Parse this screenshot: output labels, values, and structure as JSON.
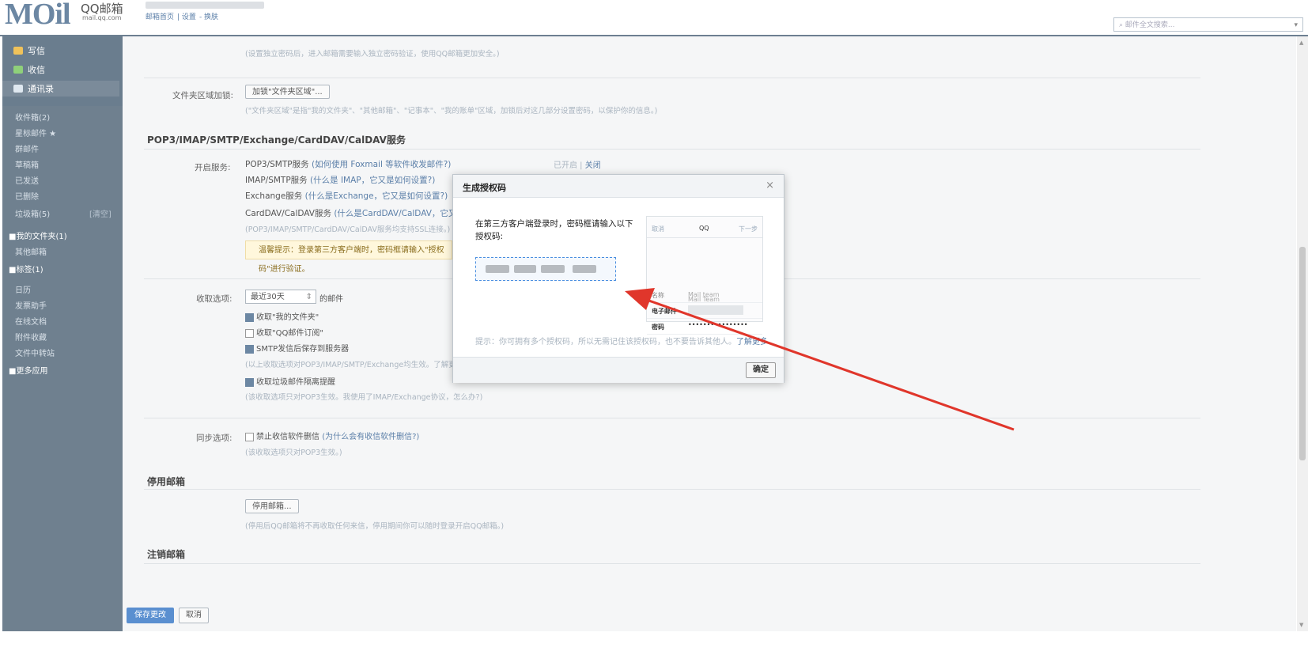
{
  "header": {
    "logo_m": "MOil",
    "logo_name": "QQ邮箱",
    "logo_domain": "mail.qq.com",
    "links": [
      "邮箱首页",
      "设置",
      "换肤"
    ],
    "search_placeholder": "邮件全文搜索..."
  },
  "sidebar": {
    "compose": "写信",
    "receive": "收信",
    "contacts": "通讯录",
    "folders": [
      {
        "label": "收件箱(2)"
      },
      {
        "label": "星标邮件 ★"
      },
      {
        "label": "群邮件"
      },
      {
        "label": "草稿箱"
      },
      {
        "label": "已发送"
      },
      {
        "label": "已删除"
      },
      {
        "label": "垃圾箱(5)"
      }
    ],
    "clear": "[清空]",
    "my_folders": "■我的文件夹(1)",
    "other_mail": "其他邮箱",
    "tags": "■标签(1)",
    "apps": [
      "日历",
      "发票助手",
      "在线文档",
      "附件收藏",
      "文件中转站"
    ],
    "more_apps": "■更多应用"
  },
  "main": {
    "top_hint": "(设置独立密码后，进入邮箱需要输入独立密码验证，使用QQ邮箱更加安全。)",
    "folder_lock_label": "文件夹区域加锁:",
    "folder_lock_btn": "加锁\"文件夹区域\"...",
    "folder_lock_hint": "(\"文件夹区域\"是指\"我的文件夹\"、\"其他邮箱\"、\"记事本\"、\"我的账单\"区域，加锁后对这几部分设置密码，以保护你的信息。)",
    "service_title": "POP3/IMAP/SMTP/Exchange/CardDAV/CalDAV服务",
    "enable_label": "开启服务:",
    "services": [
      {
        "name": "POP3/SMTP服务",
        "help": "(如何使用 Foxmail 等软件收发邮件?)"
      },
      {
        "name": "IMAP/SMTP服务",
        "help": "(什么是 IMAP，它又是如何设置?)"
      },
      {
        "name": "Exchange服务",
        "help": "(什么是Exchange，它又是如何设置?)"
      },
      {
        "name": "CardDAV/CalDAV服务",
        "help": "(什么是CardDAV/CalDAV，它又是如何设置?)"
      }
    ],
    "service_status": "已开启",
    "service_close": "关闭",
    "ssl_hint": "(POP3/IMAP/SMTP/CardDAV/CalDAV服务均支持SSL连接。)",
    "warn_text": "温馨提示：登录第三方客户端时，密码框请输入\"授权码\"进行验证。",
    "receive_label": "收取选项:",
    "receive_select": "最近30天",
    "receive_suffix": "的邮件",
    "opt_my_folders": "收取\"我的文件夹\"",
    "opt_subscriptions": "收取\"QQ邮件订阅\"",
    "opt_smtp_save": "SMTP发信后保存到服务器",
    "opt_hint": "(以上收取选项对POP3/IMAP/SMTP/Exchange均生效。了解更多)",
    "opt_junk": "收取垃圾邮件隔离提醒",
    "junk_hint": "(该收取选项只对POP3生效。我使用了IMAP/Exchange协议，怎么办?)",
    "sync_label": "同步选项:",
    "sync_opt": "禁止收信软件删信",
    "sync_help": "(为什么会有收信软件删信?)",
    "sync_hint": "(该收取选项只对POP3生效。)",
    "disable_title": "停用邮箱",
    "disable_btn": "停用邮箱...",
    "disable_hint": "(停用后QQ邮箱将不再收取任何来信，停用期间你可以随时登录开启QQ邮箱。)",
    "cancel_title": "注销邮箱",
    "save_btn": "保存更改",
    "cancel_btn": "取消"
  },
  "modal": {
    "title": "生成授权码",
    "close": "×",
    "instruction": "在第三方客户端登录时，密码框请输入以下授权码:",
    "preview": {
      "cancel": "取消",
      "app": "QQ",
      "next": "下一步",
      "name_label": "名称",
      "name_value": "Mail team",
      "email_label": "电子邮件",
      "password_label": "密码",
      "password_value": "••••••••••••••••",
      "desc_value": "Mail Team"
    },
    "tip": "提示：你可拥有多个授权码，所以无需记住该授权码，也不要告诉其他人。",
    "learn_more": "了解更多",
    "ok": "确定"
  },
  "colors": {
    "sidebar": "#6f808f",
    "link": "#5b7fa8",
    "arrow": "#e0362b",
    "code_border": "#4a8fe0"
  }
}
